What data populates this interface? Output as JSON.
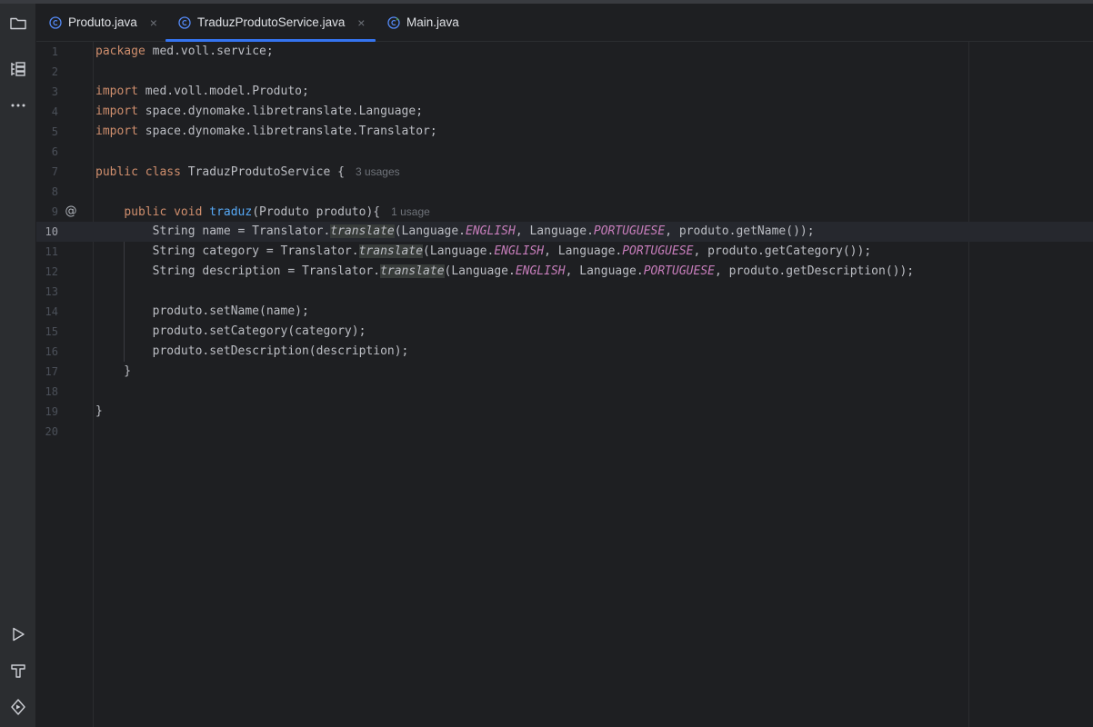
{
  "tabs": [
    {
      "label": "Produto.java",
      "icon": "java-class-icon",
      "active": false
    },
    {
      "label": "TraduzProdutoService.java",
      "icon": "java-class-icon",
      "active": true
    },
    {
      "label": "Main.java",
      "icon": "java-main-class-icon",
      "active": false
    }
  ],
  "tab_close_glyph": "×",
  "activity_bar": {
    "top": [
      "folder-icon",
      "structure-icon",
      "more-icon"
    ],
    "bottom": [
      "run-icon",
      "build-icon",
      "services-icon"
    ]
  },
  "editor": {
    "current_line": 10,
    "lines": [
      {
        "number": "1",
        "tokens": [
          [
            "kw",
            "package"
          ],
          [
            "",
            "med.voll.service;"
          ]
        ]
      },
      {
        "number": "2",
        "tokens": []
      },
      {
        "number": "3",
        "tokens": [
          [
            "kw",
            "import"
          ],
          [
            "",
            "med.voll.model.Produto;"
          ]
        ]
      },
      {
        "number": "4",
        "tokens": [
          [
            "kw",
            "import"
          ],
          [
            "",
            "space.dynomake.libretranslate.Language;"
          ]
        ]
      },
      {
        "number": "5",
        "tokens": [
          [
            "kw",
            "import"
          ],
          [
            "",
            "space.dynomake.libretranslate.Translator;"
          ]
        ]
      },
      {
        "number": "6",
        "tokens": []
      },
      {
        "number": "7",
        "tokens": [
          [
            "kw",
            "public"
          ],
          [
            "kw",
            "class"
          ],
          [
            "",
            "TraduzProdutoService {"
          ]
        ],
        "hint": "3 usages"
      },
      {
        "number": "8",
        "tokens": []
      },
      {
        "number": "9",
        "gutter_icon": "@",
        "tokens": [
          [
            "",
            "    "
          ],
          [
            "kw",
            "public"
          ],
          [
            "kw",
            "void"
          ],
          [
            "fn",
            "traduz"
          ],
          [
            "",
            "(Produto produto){"
          ]
        ],
        "hint": "1 usage"
      },
      {
        "number": "10",
        "tokens": [
          [
            "",
            "        String name = Translator."
          ],
          [
            "it hl",
            "translate"
          ],
          [
            "",
            "(Language."
          ],
          [
            "st",
            "ENGLISH"
          ],
          [
            "",
            ", Language."
          ],
          [
            "st",
            "PORTUGUESE"
          ],
          [
            "",
            ", produto.getName());"
          ]
        ]
      },
      {
        "number": "11",
        "tokens": [
          [
            "",
            "        String category = Translator."
          ],
          [
            "it hl",
            "translate"
          ],
          [
            "",
            "(Language."
          ],
          [
            "st",
            "ENGLISH"
          ],
          [
            "",
            ", Language."
          ],
          [
            "st",
            "PORTUGUESE"
          ],
          [
            "",
            ", produto.getCategory());"
          ]
        ]
      },
      {
        "number": "12",
        "tokens": [
          [
            "",
            "        String description = Translator."
          ],
          [
            "it hl",
            "translate"
          ],
          [
            "",
            "(Language."
          ],
          [
            "st",
            "ENGLISH"
          ],
          [
            "",
            ", Language."
          ],
          [
            "st",
            "PORTUGUESE"
          ],
          [
            "",
            ", produto.getDescription());"
          ]
        ]
      },
      {
        "number": "13",
        "tokens": []
      },
      {
        "number": "14",
        "tokens": [
          [
            "",
            "        produto.setName(name);"
          ]
        ]
      },
      {
        "number": "15",
        "tokens": [
          [
            "",
            "        produto.setCategory(category);"
          ]
        ]
      },
      {
        "number": "16",
        "tokens": [
          [
            "",
            "        produto.setDescription(description);"
          ]
        ]
      },
      {
        "number": "17",
        "tokens": [
          [
            "",
            "    }"
          ]
        ]
      },
      {
        "number": "18",
        "tokens": []
      },
      {
        "number": "19",
        "tokens": [
          [
            "",
            "}"
          ]
        ]
      },
      {
        "number": "20",
        "tokens": []
      }
    ]
  },
  "colors": {
    "accent": "#3574f0",
    "keyword": "#cf8e6d",
    "function": "#56a8f5",
    "static_field": "#c77dbb",
    "text": "#bcbec4",
    "background": "#1e1f22"
  }
}
